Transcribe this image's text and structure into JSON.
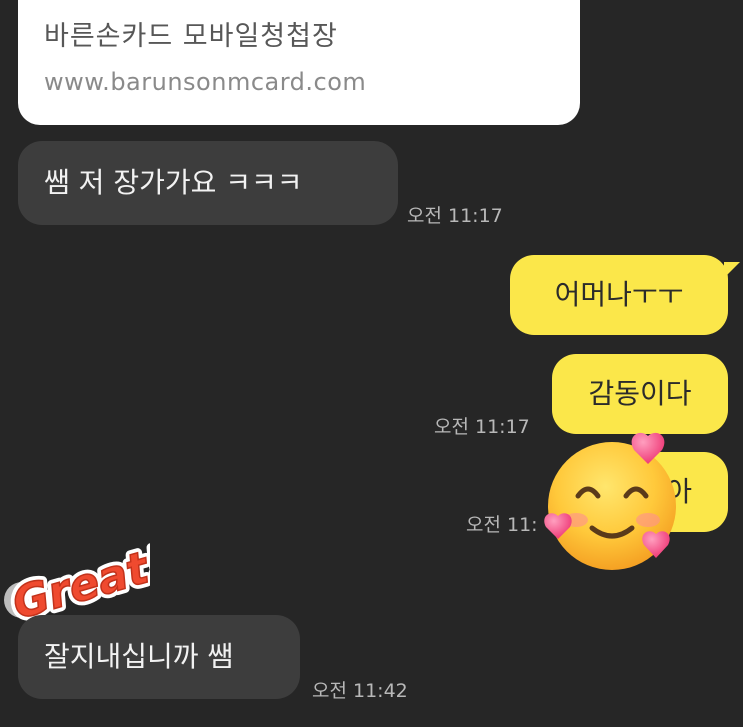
{
  "link_card": {
    "title": "바른손카드 모바일청첩장",
    "url": "www.barunsonmcard.com"
  },
  "messages": [
    {
      "text": "쌤 저 장가가요 ㅋㅋㅋ",
      "time": "오전 11:17"
    },
    {
      "text": "어머나ㅜㅜ"
    },
    {
      "text": "감동이다",
      "time": "오전 11:17"
    },
    {
      "text": "아",
      "time": "오전 11:"
    },
    {
      "text": "잘지내십니까 쌤",
      "time": "오전 11:42"
    }
  ],
  "sticker": {
    "text": "Great!"
  },
  "emoji": {
    "name": "smiling-face-with-hearts-icon"
  },
  "colors": {
    "background": "#262626",
    "incoming_bubble": "#3d3d3d",
    "outgoing_bubble": "#fbe74a",
    "card": "#ffffff"
  }
}
